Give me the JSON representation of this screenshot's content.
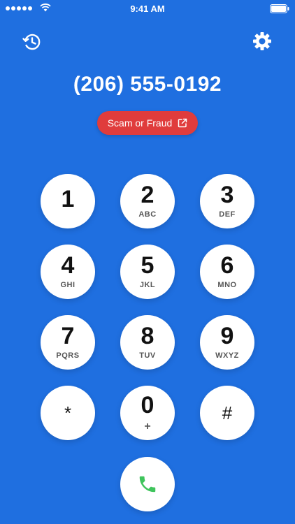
{
  "status_bar": {
    "time": "9:41 AM"
  },
  "phone_number": "(206) 555-0192",
  "scam_label": "Scam or Fraud",
  "keypad": [
    {
      "digit": "1",
      "letters": ""
    },
    {
      "digit": "2",
      "letters": "ABC"
    },
    {
      "digit": "3",
      "letters": "DEF"
    },
    {
      "digit": "4",
      "letters": "GHI"
    },
    {
      "digit": "5",
      "letters": "JKL"
    },
    {
      "digit": "6",
      "letters": "MNO"
    },
    {
      "digit": "7",
      "letters": "PQRS"
    },
    {
      "digit": "8",
      "letters": "TUV"
    },
    {
      "digit": "9",
      "letters": "WXYZ"
    },
    {
      "digit": "*",
      "letters": ""
    },
    {
      "digit": "0",
      "letters": "+"
    },
    {
      "digit": "#",
      "letters": ""
    }
  ],
  "colors": {
    "background": "#1f6fe0",
    "scam_badge": "#e03c3c",
    "call_icon": "#3fc45c"
  },
  "icons": {
    "recents": "clock-history-icon",
    "settings": "gear-icon",
    "external_link": "external-link-icon",
    "call": "phone-icon"
  }
}
